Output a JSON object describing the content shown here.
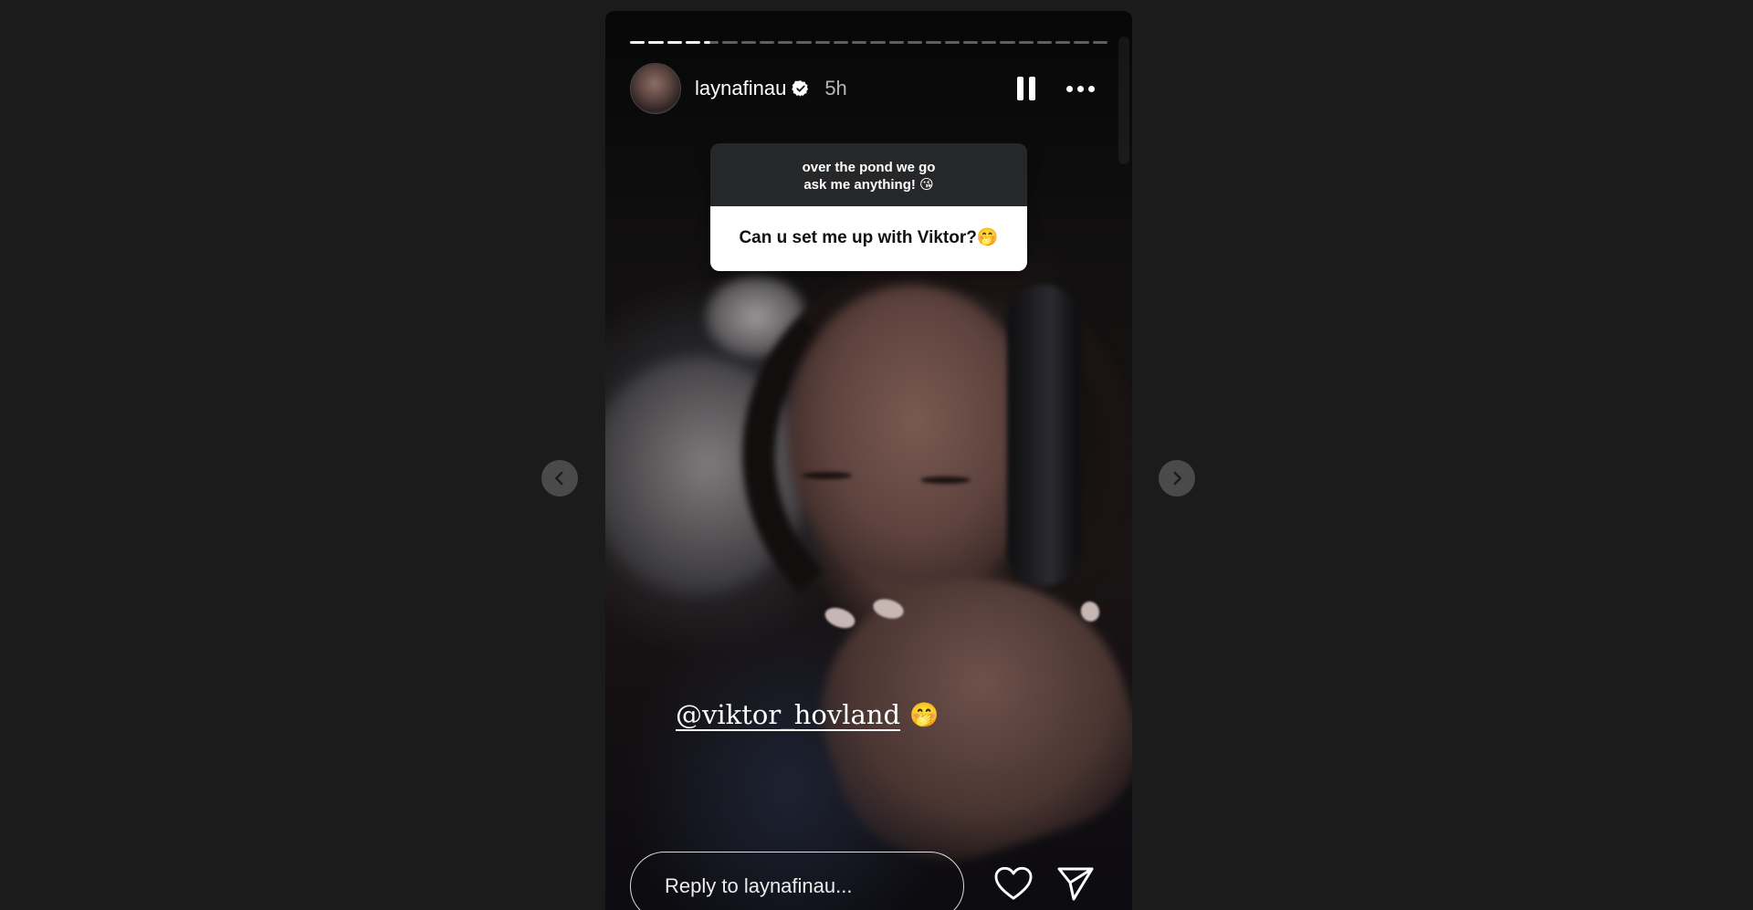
{
  "story": {
    "username": "laynafinau",
    "timestamp": "5h",
    "verified": true,
    "progress": {
      "total_segments": 26,
      "completed_segments": 4,
      "current_segment_fraction": 0.4
    },
    "question_sticker": {
      "prompt_line1": "over the pond we go",
      "prompt_line2": "ask me anything! 😘",
      "answer": "Can u set me up with Viktor?🤭"
    },
    "mention": {
      "handle": "@viktor_hovland",
      "emoji": "🤭"
    },
    "reply": {
      "placeholder": "Reply to laynafinau..."
    }
  },
  "icons": {
    "verified": "verified-badge-icon",
    "pause": "pause-icon",
    "more": "more-options-icon",
    "like": "heart-icon",
    "share": "send-icon",
    "prev": "chevron-left-icon",
    "next": "chevron-right-icon"
  },
  "colors": {
    "page_background": "#1b1b1b",
    "sticker_top": "#262729",
    "sticker_bottom": "#ffffff",
    "verified_badge": "#ffffff"
  }
}
